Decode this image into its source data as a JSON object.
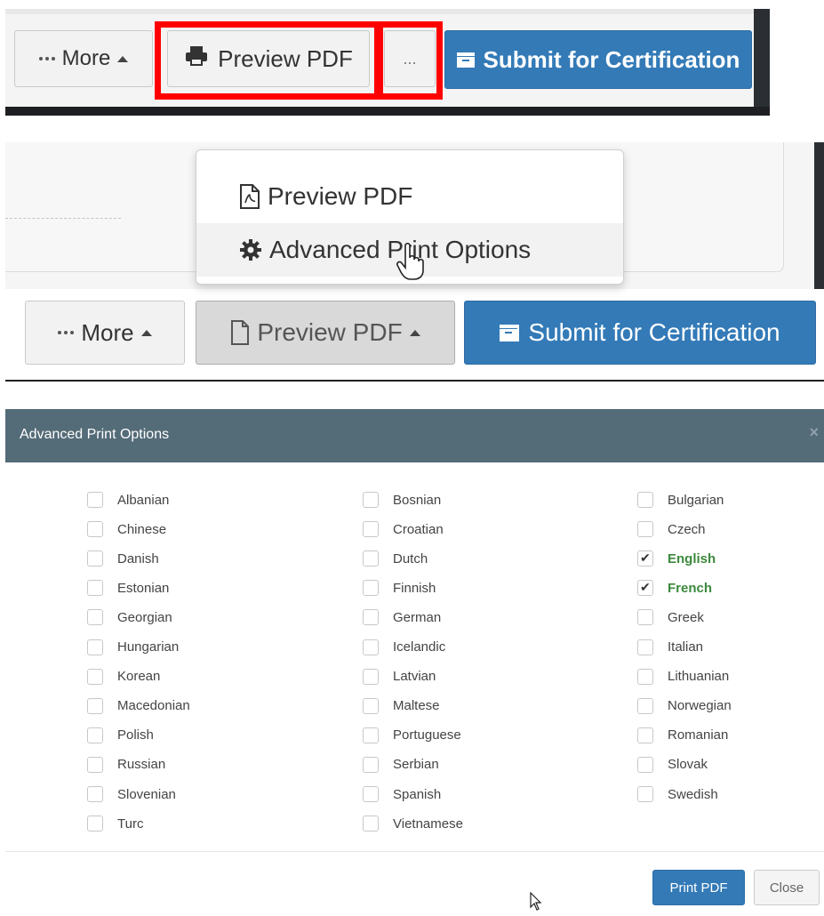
{
  "panel1": {
    "more_label": "More",
    "preview_label": "Preview PDF",
    "ellipsis_label": "...",
    "submit_label": "Submit for Certification"
  },
  "panel2": {
    "menu_items": [
      "Preview PDF",
      "Advanced Print Options"
    ],
    "more_label": "More",
    "preview_label": "Preview PDF",
    "submit_label": "Submit for Certification"
  },
  "modal": {
    "title": "Advanced Print Options",
    "close_x": "×",
    "languages": [
      {
        "label": "Albanian",
        "checked": false
      },
      {
        "label": "Bosnian",
        "checked": false
      },
      {
        "label": "Bulgarian",
        "checked": false
      },
      {
        "label": "Chinese",
        "checked": false
      },
      {
        "label": "Croatian",
        "checked": false
      },
      {
        "label": "Czech",
        "checked": false
      },
      {
        "label": "Danish",
        "checked": false
      },
      {
        "label": "Dutch",
        "checked": false
      },
      {
        "label": "English",
        "checked": true
      },
      {
        "label": "Estonian",
        "checked": false
      },
      {
        "label": "Finnish",
        "checked": false
      },
      {
        "label": "French",
        "checked": true
      },
      {
        "label": "Georgian",
        "checked": false
      },
      {
        "label": "German",
        "checked": false
      },
      {
        "label": "Greek",
        "checked": false
      },
      {
        "label": "Hungarian",
        "checked": false
      },
      {
        "label": "Icelandic",
        "checked": false
      },
      {
        "label": "Italian",
        "checked": false
      },
      {
        "label": "Korean",
        "checked": false
      },
      {
        "label": "Latvian",
        "checked": false
      },
      {
        "label": "Lithuanian",
        "checked": false
      },
      {
        "label": "Macedonian",
        "checked": false
      },
      {
        "label": "Maltese",
        "checked": false
      },
      {
        "label": "Norwegian",
        "checked": false
      },
      {
        "label": "Polish",
        "checked": false
      },
      {
        "label": "Portuguese",
        "checked": false
      },
      {
        "label": "Romanian",
        "checked": false
      },
      {
        "label": "Russian",
        "checked": false
      },
      {
        "label": "Serbian",
        "checked": false
      },
      {
        "label": "Slovak",
        "checked": false
      },
      {
        "label": "Slovenian",
        "checked": false
      },
      {
        "label": "Spanish",
        "checked": false
      },
      {
        "label": "Swedish",
        "checked": false
      },
      {
        "label": "Turc",
        "checked": false
      },
      {
        "label": "Vietnamese",
        "checked": false
      }
    ],
    "print_label": "Print PDF",
    "close_label": "Close"
  },
  "colors": {
    "primary": "#337ab7",
    "modal_header": "#546b78",
    "highlight": "#ff0000",
    "checked_text": "#3c8a3c"
  }
}
